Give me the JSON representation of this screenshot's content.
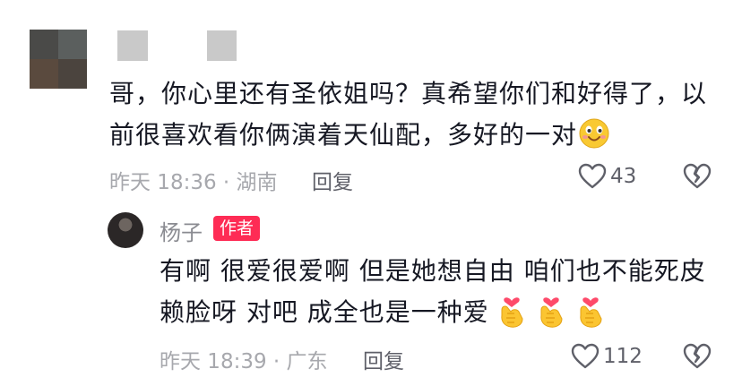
{
  "comment": {
    "text": "哥，你心里还有圣依姐吗？真希望你们和好得了，以前很喜欢看你俩演着天仙配，多好的一对",
    "emoji": "smiling-face-emoji",
    "time_location": "昨天 18:36 · 湖南",
    "reply_label": "回复",
    "like_count": "43"
  },
  "reply": {
    "author": "杨子",
    "badge": "作者",
    "text": "有啊 很爱很爱啊 但是她想自由 咱们也不能死皮赖脸呀 对吧 成全也是一种爱",
    "emojis": [
      "finger-heart-emoji",
      "finger-heart-emoji",
      "finger-heart-emoji"
    ],
    "time_location": "昨天 18:39 · 广东",
    "reply_label": "回复",
    "like_count": "112"
  },
  "colors": {
    "text": "#161823",
    "meta": "#a7a8ad",
    "badge": "#fe2c55"
  }
}
